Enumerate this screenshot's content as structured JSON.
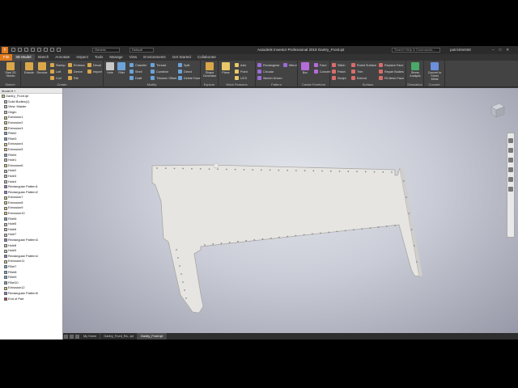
{
  "title_bar": {
    "logo": "I",
    "appearance_field": "Generic",
    "default_field": "Default",
    "title": "Autodesk Inventor Professional 2019   Gantry_Front.ipt",
    "search_placeholder": "Search Help & Commands...",
    "user": "patrick9e568",
    "window_controls": [
      "–",
      "□",
      "✕"
    ]
  },
  "ribbon_tabs": [
    "File",
    "3D Model",
    "Sketch",
    "Annotate",
    "Inspect",
    "Tools",
    "Manage",
    "View",
    "Environments",
    "Get Started",
    "Collaborate"
  ],
  "ribbon": {
    "sketch": {
      "panel": "Sketch",
      "start": "Start 2D Sketch"
    },
    "create": {
      "panel": "Create",
      "extrude": "Extrude",
      "revolve": "Revolve",
      "col1": [
        "Sweep",
        "Loft",
        "Coil"
      ],
      "col2": [
        "Emboss",
        "Derive",
        "Rib"
      ],
      "col3": [
        "Decal",
        "Import",
        ""
      ]
    },
    "modify": {
      "panel": "Modify",
      "hole": "Hole",
      "fillet": "Fillet",
      "col1": [
        "Chamfer",
        "Shell",
        "Draft"
      ],
      "col2": [
        "Thread",
        "Combine",
        "Thicken/ Offset"
      ],
      "col3": [
        "Split",
        "Direct",
        "Delete Face"
      ]
    },
    "explore": {
      "panel": "Explore",
      "shape": "Shape Generator"
    },
    "work": {
      "panel": "Work Features",
      "plane": "Plane",
      "col1": [
        "Axis",
        "Point",
        "UCS"
      ]
    },
    "pattern": {
      "panel": "Pattern",
      "col1": [
        "Rectangular",
        "Circular",
        "Sketch Driven"
      ],
      "mirror": "Mirror"
    },
    "freeform": {
      "panel": "Create Freeform",
      "box": "Box",
      "col1": [
        "Face",
        "Convert",
        ""
      ]
    },
    "surface": {
      "panel": "Surface",
      "col1": [
        "Stitch",
        "Patch",
        "Sculpt"
      ],
      "col2": [
        "Ruled Surface",
        "Trim",
        "Extend"
      ],
      "col3": [
        "Replace Face",
        "Repair Bodies",
        "Fit Mesh Face"
      ]
    },
    "simulation": {
      "panel": "Simulation",
      "stress": "Stress Analysis"
    },
    "convert": {
      "panel": "Convert",
      "sheet": "Convert to Sheet Metal"
    }
  },
  "browser": {
    "header": "Model ▾  +",
    "nodes": [
      {
        "t": "Gantry_Front.ipt",
        "k": "root"
      },
      {
        "t": "Solid Bodies(1)",
        "k": "f"
      },
      {
        "t": "View: Master",
        "k": "f"
      },
      {
        "t": "Origin",
        "k": "f"
      },
      {
        "t": "Extrusion1",
        "k": "e"
      },
      {
        "t": "Extrusion2",
        "k": "e"
      },
      {
        "t": "Extrusion3",
        "k": "e"
      },
      {
        "t": "Fillet2",
        "k": "fl"
      },
      {
        "t": "Fillet3",
        "k": "fl"
      },
      {
        "t": "Extrusion4",
        "k": "e"
      },
      {
        "t": "Extrusion5",
        "k": "e"
      },
      {
        "t": "Fillet4",
        "k": "fl"
      },
      {
        "t": "Hole1",
        "k": "h"
      },
      {
        "t": "Extrusion6",
        "k": "e"
      },
      {
        "t": "Hole2",
        "k": "h"
      },
      {
        "t": "Hole3",
        "k": "h"
      },
      {
        "t": "Hole4",
        "k": "h"
      },
      {
        "t": "Rectangular Pattern1",
        "k": "p"
      },
      {
        "t": "Rectangular Pattern2",
        "k": "p"
      },
      {
        "t": "Extrusion7",
        "k": "e"
      },
      {
        "t": "Extrusion8",
        "k": "e"
      },
      {
        "t": "Extrusion9",
        "k": "e"
      },
      {
        "t": "Extrusion10",
        "k": "e"
      },
      {
        "t": "Fillet5",
        "k": "fl"
      },
      {
        "t": "Hole5",
        "k": "h"
      },
      {
        "t": "Hole6",
        "k": "h"
      },
      {
        "t": "Hole7",
        "k": "h"
      },
      {
        "t": "Rectangular Pattern3",
        "k": "p"
      },
      {
        "t": "Hole8",
        "k": "h"
      },
      {
        "t": "Hole9",
        "k": "h"
      },
      {
        "t": "Rectangular Pattern4",
        "k": "p"
      },
      {
        "t": "Extrusion11",
        "k": "e"
      },
      {
        "t": "Fillet7",
        "k": "fl"
      },
      {
        "t": "Fillet8",
        "k": "fl"
      },
      {
        "t": "Fillet9",
        "k": "fl"
      },
      {
        "t": "Fillet10",
        "k": "fl"
      },
      {
        "t": "Extrusion12",
        "k": "e"
      },
      {
        "t": "Rectangular Pattern5",
        "k": "p"
      },
      {
        "t": "End of Part",
        "k": "end"
      }
    ]
  },
  "doc_tabs": [
    "My Home",
    "Gantry_Front_Ra...ipt",
    "Gantry_Front.ipt"
  ],
  "colors": {
    "accent": "#e07a1f",
    "part": "#e4e3e0",
    "viewport_bg": "#c9cbd6"
  }
}
